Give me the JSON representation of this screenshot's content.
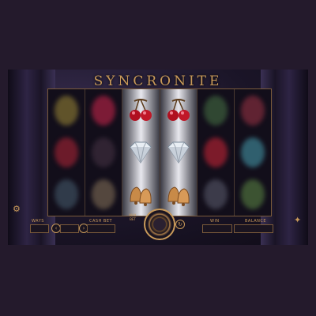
{
  "game": {
    "title": "SYNCRONITE"
  },
  "controls": {
    "ways_label": "WAYS",
    "cash_bet_label": "CASH BET",
    "max_bet_label": "MAX BET",
    "win_label": "WIN",
    "balance_label": "BALANCE"
  },
  "symbols": {
    "active_reel_1": [
      "cherries-icon",
      "diamond-icon",
      "bells-icon"
    ],
    "active_reel_2": [
      "cherries-icon",
      "diamond-icon",
      "bells-icon"
    ]
  },
  "colors": {
    "accent": "#c99a5a",
    "background": "#241a2c"
  }
}
